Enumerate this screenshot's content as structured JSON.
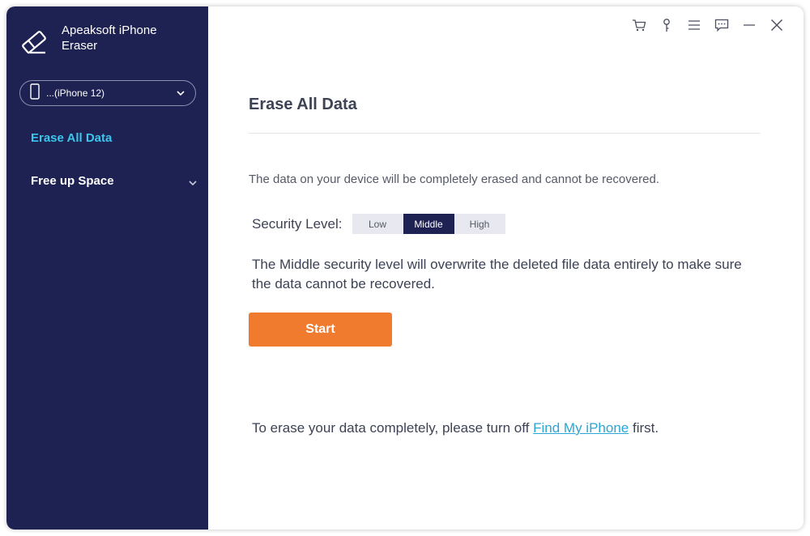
{
  "app": {
    "name": "Apeaksoft iPhone Eraser"
  },
  "sidebar": {
    "device_label": "...(iPhone 12)",
    "items": [
      {
        "label": "Erase All Data",
        "active": true
      },
      {
        "label": "Free up Space",
        "active": false
      }
    ]
  },
  "titlebar": {
    "icons": [
      "cart-icon",
      "key-icon",
      "menu-icon",
      "feedback-icon",
      "minimize-icon",
      "close-icon"
    ]
  },
  "main": {
    "title": "Erase All Data",
    "description": "The data on your device will be completely erased and cannot be recovered.",
    "security_label": "Security Level:",
    "security_options": [
      "Low",
      "Middle",
      "High"
    ],
    "security_selected": "Middle",
    "security_info": "The Middle security level will overwrite the deleted file data entirely to make sure the data cannot be recovered.",
    "start_label": "Start",
    "note_prefix": "To erase your data completely, please turn off ",
    "note_link": "Find My iPhone",
    "note_suffix": " first."
  },
  "colors": {
    "sidebar_bg": "#1e2252",
    "accent_active": "#3cc6ec",
    "start_button": "#f07b2e",
    "link": "#2aa6d4"
  }
}
